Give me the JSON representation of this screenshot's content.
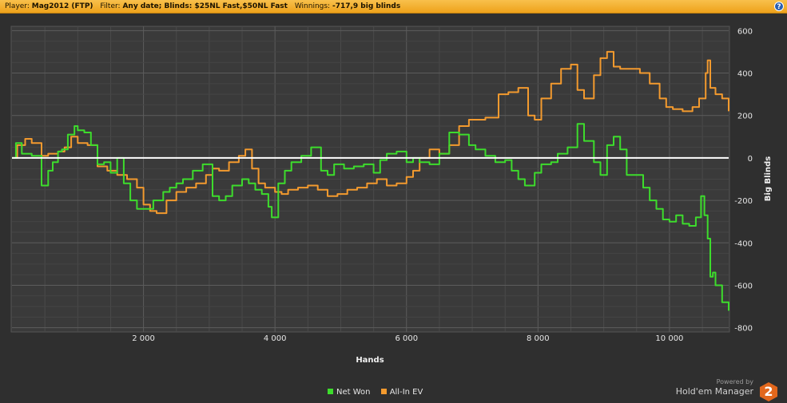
{
  "header": {
    "player_label": "Player:",
    "player_value": "Mag2012 (FTP)",
    "filter_label": "Filter:",
    "filter_value": "Any date; Blinds: $25NL Fast,$50NL Fast",
    "winnings_label": "Winnings:",
    "winnings_value": "-717,9 big blinds",
    "help_label": "?"
  },
  "branding": {
    "powered_by": "Powered by",
    "product": "Hold'em Manager",
    "logo_text": "2",
    "logo_color": "#e2671c"
  },
  "chart_data": {
    "type": "line",
    "xlabel": "Hands",
    "ylabel": "Big Blinds",
    "xlim": [
      0,
      10900
    ],
    "ylim": [
      -820,
      620
    ],
    "x_ticks": [
      2000,
      4000,
      6000,
      8000,
      10000
    ],
    "x_tick_labels": [
      "2 000",
      "4 000",
      "6 000",
      "8 000",
      "10 000"
    ],
    "y_ticks": [
      600,
      400,
      200,
      0,
      -200,
      -400,
      -600,
      -800
    ],
    "y_tick_labels": [
      "600",
      "400",
      "200",
      "0",
      "-200",
      "-400",
      "-600",
      "-800"
    ],
    "grid": true,
    "legend_position": "bottom-center",
    "series": [
      {
        "name": "Net Won",
        "color": "#3ddc2c",
        "x": [
          0,
          60,
          150,
          300,
          450,
          550,
          620,
          700,
          760,
          850,
          950,
          1000,
          1100,
          1200,
          1300,
          1400,
          1500,
          1600,
          1700,
          1800,
          1900,
          2050,
          2150,
          2300,
          2400,
          2500,
          2600,
          2750,
          2900,
          3050,
          3150,
          3250,
          3350,
          3500,
          3600,
          3700,
          3800,
          3900,
          3950,
          4050,
          4150,
          4250,
          4400,
          4550,
          4700,
          4800,
          4900,
          5050,
          5200,
          5350,
          5500,
          5600,
          5700,
          5850,
          6000,
          6100,
          6200,
          6350,
          6500,
          6650,
          6800,
          6950,
          7050,
          7200,
          7350,
          7500,
          7600,
          7700,
          7800,
          7950,
          8050,
          8200,
          8300,
          8450,
          8600,
          8700,
          8850,
          8950,
          9050,
          9150,
          9250,
          9350,
          9450,
          9600,
          9700,
          9800,
          9900,
          10000,
          10100,
          10200,
          10300,
          10400,
          10480,
          10530,
          10580,
          10620,
          10660,
          10700,
          10800,
          10900
        ],
        "y": [
          0,
          70,
          20,
          10,
          -130,
          -60,
          -20,
          30,
          40,
          110,
          150,
          130,
          120,
          60,
          -30,
          -20,
          -70,
          0,
          -120,
          -200,
          -240,
          -240,
          -200,
          -160,
          -140,
          -120,
          -100,
          -60,
          -30,
          -180,
          -200,
          -180,
          -130,
          -100,
          -120,
          -150,
          -170,
          -230,
          -280,
          -120,
          -60,
          -20,
          10,
          50,
          -60,
          -80,
          -30,
          -50,
          -40,
          -30,
          -70,
          -10,
          20,
          30,
          -20,
          0,
          -20,
          -30,
          20,
          120,
          110,
          60,
          40,
          10,
          -20,
          -10,
          -60,
          -100,
          -130,
          -70,
          -30,
          -20,
          20,
          50,
          160,
          80,
          -20,
          -80,
          60,
          100,
          40,
          -80,
          -80,
          -140,
          -200,
          -240,
          -290,
          -300,
          -270,
          -310,
          -320,
          -280,
          -180,
          -270,
          -380,
          -560,
          -540,
          -600,
          -680,
          -720
        ]
      },
      {
        "name": "All-In EV",
        "color": "#f39a2e",
        "x": [
          0,
          80,
          200,
          300,
          450,
          550,
          700,
          800,
          900,
          1000,
          1150,
          1300,
          1450,
          1600,
          1750,
          1900,
          2000,
          2100,
          2200,
          2350,
          2500,
          2650,
          2800,
          2950,
          3050,
          3150,
          3300,
          3450,
          3550,
          3650,
          3750,
          3850,
          4000,
          4100,
          4200,
          4350,
          4500,
          4650,
          4800,
          4950,
          5100,
          5250,
          5400,
          5550,
          5700,
          5850,
          6000,
          6100,
          6200,
          6350,
          6500,
          6650,
          6800,
          6950,
          7050,
          7200,
          7400,
          7550,
          7700,
          7850,
          7950,
          8050,
          8200,
          8350,
          8500,
          8600,
          8700,
          8850,
          8950,
          9050,
          9150,
          9250,
          9400,
          9550,
          9700,
          9850,
          9950,
          10050,
          10200,
          10350,
          10450,
          10550,
          10580,
          10620,
          10700,
          10800,
          10900
        ],
        "y": [
          0,
          60,
          90,
          70,
          10,
          20,
          30,
          50,
          100,
          70,
          60,
          -40,
          -60,
          -80,
          -100,
          -140,
          -220,
          -250,
          -260,
          -200,
          -160,
          -140,
          -120,
          -80,
          -50,
          -60,
          -20,
          10,
          40,
          -50,
          -120,
          -140,
          -160,
          -170,
          -150,
          -140,
          -130,
          -150,
          -180,
          -170,
          -150,
          -140,
          -120,
          -100,
          -130,
          -120,
          -90,
          -60,
          0,
          40,
          20,
          60,
          150,
          180,
          180,
          190,
          300,
          310,
          330,
          200,
          180,
          280,
          350,
          420,
          440,
          320,
          280,
          390,
          470,
          500,
          430,
          420,
          420,
          400,
          350,
          280,
          240,
          230,
          220,
          240,
          280,
          400,
          460,
          330,
          300,
          280,
          220
        ]
      }
    ]
  }
}
